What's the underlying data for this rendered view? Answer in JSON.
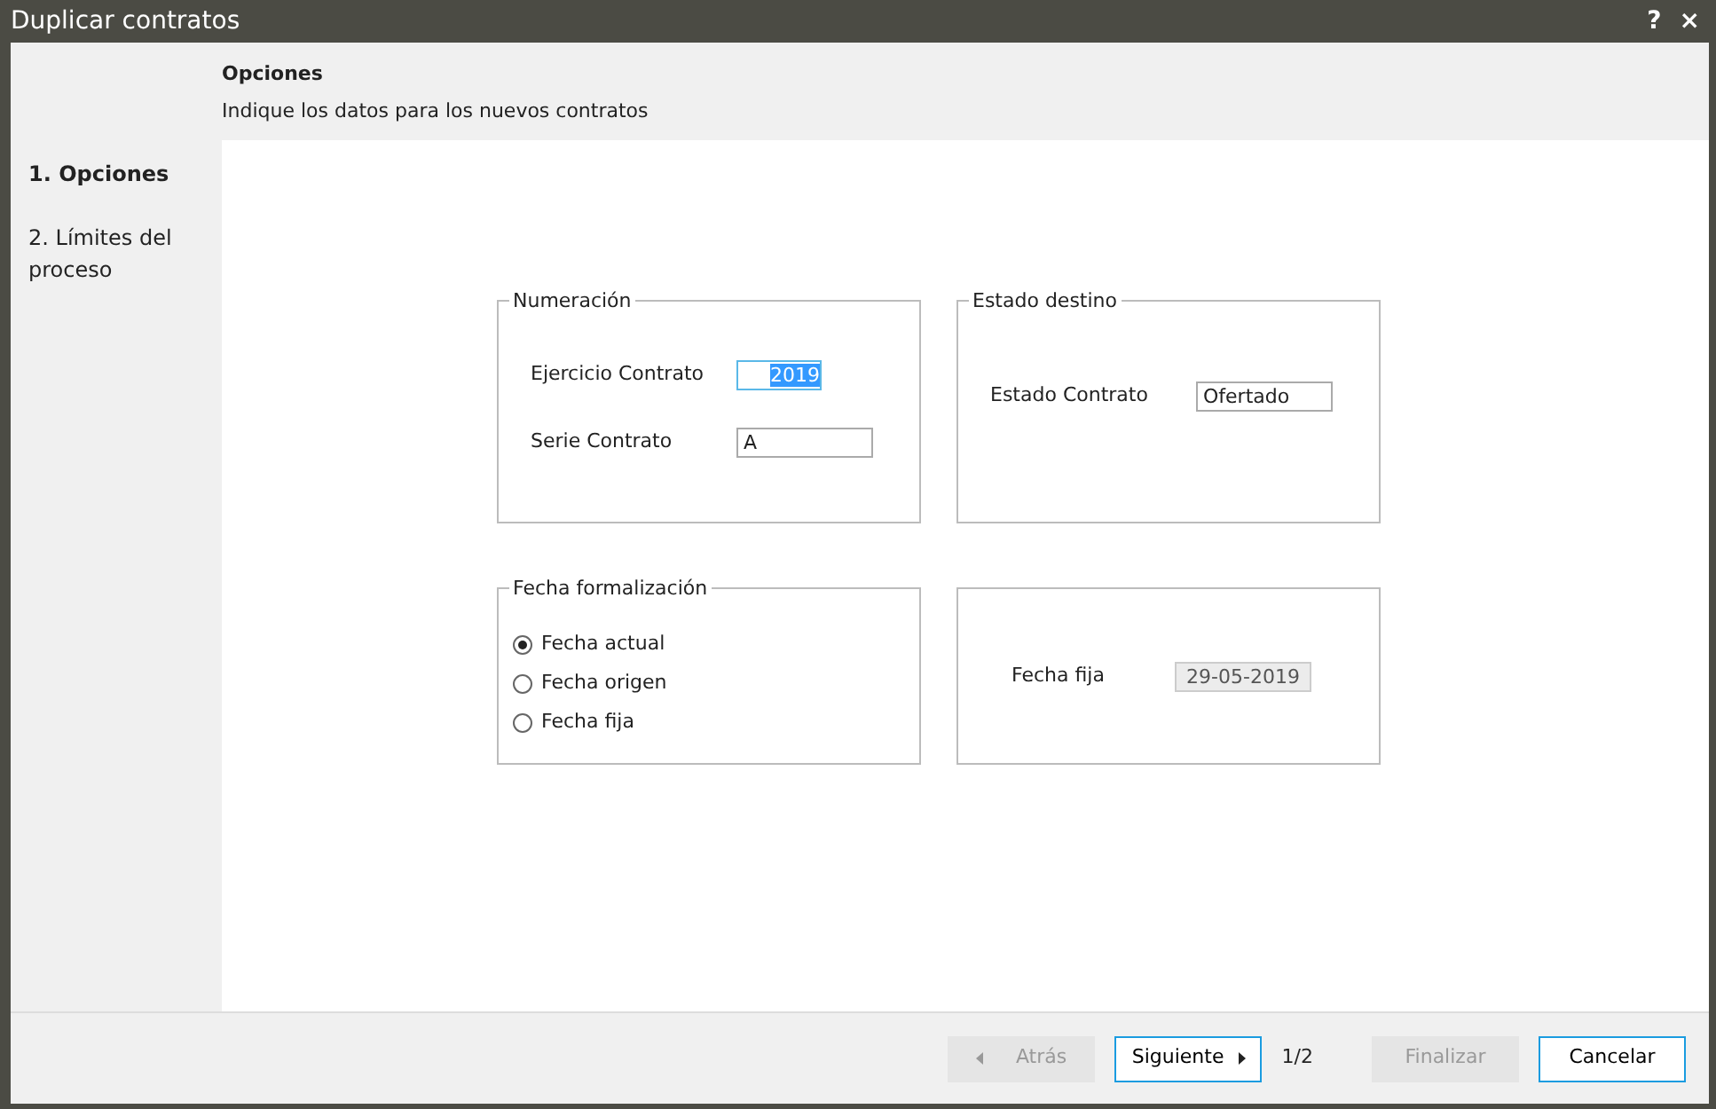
{
  "window": {
    "title": "Duplicar contratos",
    "help": "?",
    "close": "×"
  },
  "header": {
    "title": "Opciones",
    "subtitle": "Indique los datos para los nuevos contratos"
  },
  "steps": [
    {
      "label": "1. Opciones",
      "selected": true
    },
    {
      "label": "2. Límites del proceso",
      "selected": false
    }
  ],
  "groups": [
    {
      "title": "Numeración",
      "kind": "fields",
      "fields": [
        {
          "label": "Ejercicio Contrato",
          "value": "2019",
          "selected": true,
          "disabled": false
        },
        {
          "label": "Serie Contrato",
          "value": "A",
          "selected": false,
          "disabled": false
        }
      ]
    },
    {
      "title": "Estado destino",
      "kind": "fields",
      "fields": [
        {
          "label": "Estado Contrato",
          "value": "Ofertado",
          "selected": false,
          "disabled": false
        }
      ]
    },
    {
      "title": "Fecha formalización",
      "kind": "radios",
      "options": [
        {
          "label": "Fecha actual",
          "selected": true
        },
        {
          "label": "Fecha origen",
          "selected": false
        },
        {
          "label": "Fecha fija",
          "selected": false
        }
      ]
    },
    {
      "kind": "fields",
      "fields": [
        {
          "label": "Fecha fija",
          "value": "29-05-2019",
          "selected": false,
          "disabled": true
        }
      ]
    }
  ],
  "footer": {
    "buttons": [
      {
        "label": "Atrás",
        "kind": "back",
        "disabled": true
      },
      {
        "label": "Siguiente",
        "kind": "next",
        "disabled": false
      },
      {
        "label": "Finalizar",
        "kind": "plain",
        "disabled": true
      },
      {
        "label": "Cancelar",
        "kind": "plain",
        "disabled": false
      }
    ],
    "page": "1/2"
  }
}
